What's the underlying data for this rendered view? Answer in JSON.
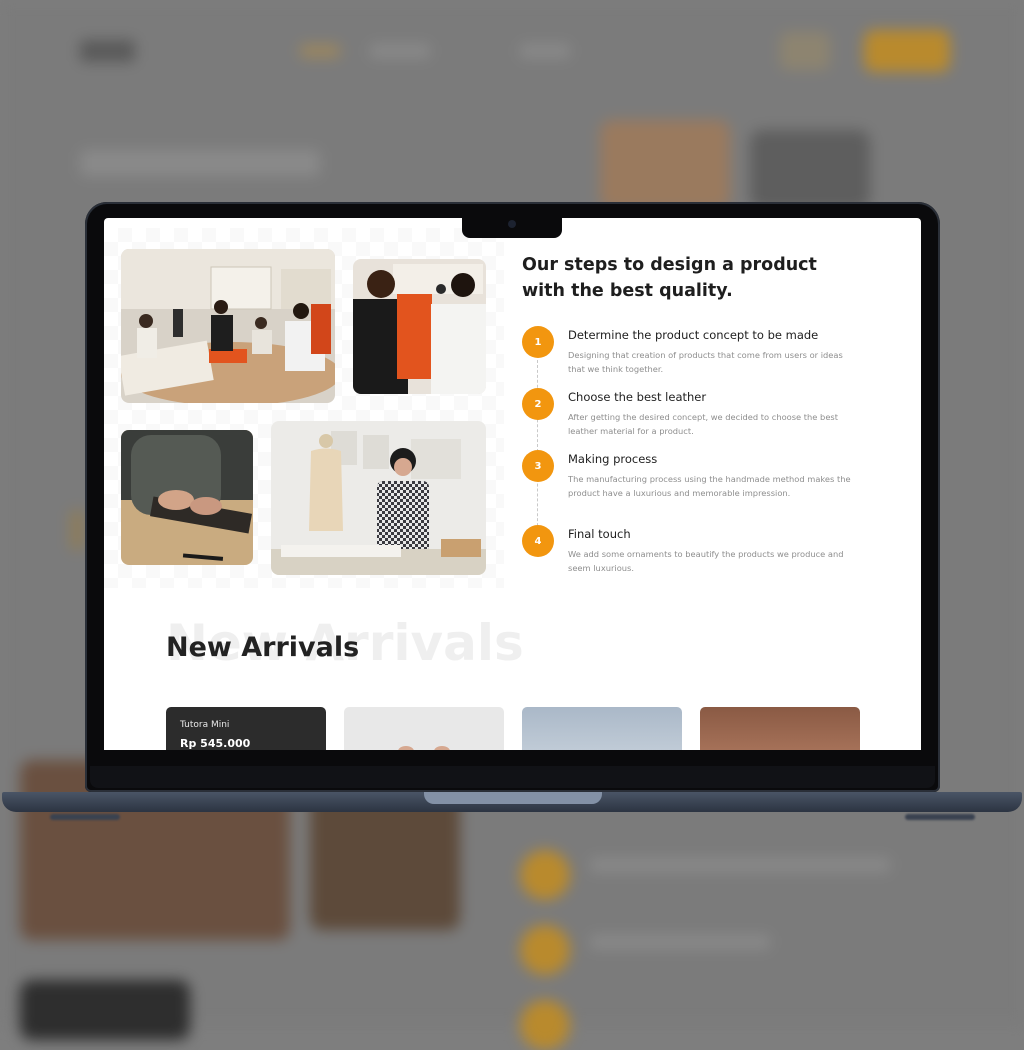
{
  "steps_section": {
    "title": "Our steps to design a product with the best quality.",
    "steps": [
      {
        "number": "1",
        "title": "Determine the product concept to be made",
        "description": "Designing that creation of products that come from users or ideas that we think together."
      },
      {
        "number": "2",
        "title": "Choose the best leather",
        "description": "After getting the desired concept, we decided to choose the best leather material for a product."
      },
      {
        "number": "3",
        "title": "Making process",
        "description": "The manufacturing process using the handmade method makes the product have a luxurious and memorable impression."
      },
      {
        "number": "4",
        "title": "Final touch",
        "description": "We add some ornaments to beautify the products we produce and seem luxurious."
      }
    ]
  },
  "new_arrivals": {
    "title": "New Arrivals",
    "ghost_title": "New Arrivals",
    "products": [
      {
        "name": "Tutora Mini",
        "price": "Rp 545.000"
      }
    ]
  },
  "colors": {
    "accent": "#f2960f",
    "heading": "#1e1e1e",
    "muted_text": "#8e8e8e",
    "laptop_body": "#2c3442"
  },
  "images": [
    "team-meeting-photo",
    "fitting-mannequin-photo",
    "leather-cutting-photo",
    "designer-studio-photo"
  ]
}
